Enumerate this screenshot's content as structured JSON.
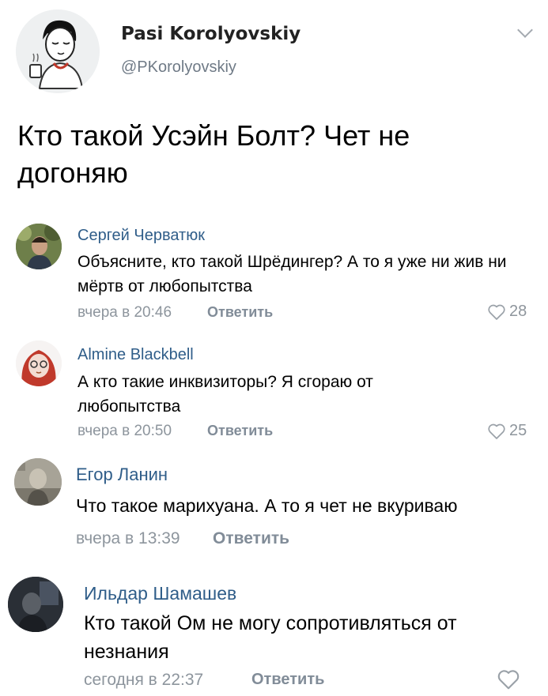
{
  "post": {
    "author_name": "Pasi Korolyovskiy",
    "handle": "@PKorolyovskiy",
    "text": "Кто такой Усэйн Болт? Чет не догоняю"
  },
  "comments": [
    {
      "name": "Сергей Черватюк",
      "text": "Объясните, кто такой Шрёдингер? А то я уже ни жив ни мёртв от любопытства",
      "time": "вчера в 20:46",
      "reply": "Ответить",
      "likes": "28"
    },
    {
      "name": "Almine Blackbell",
      "text": "А кто такие инквизиторы? Я сгораю от любопытства",
      "time": "вчера в 20:50",
      "reply": "Ответить",
      "likes": "25"
    },
    {
      "name": "Егор Ланин",
      "text": "Что такое марихуана. А то я чет не вкуриваю",
      "time": "вчера в 13:39",
      "reply": "Ответить"
    },
    {
      "name": "Ильдар Шамашев",
      "text": "Кто такой Ом не могу сопротивляться от незнания",
      "time": "сегодня в 22:37",
      "reply": "Ответить"
    }
  ],
  "icons": {
    "menu": "chevron-down-icon",
    "like": "heart-outline-icon"
  }
}
